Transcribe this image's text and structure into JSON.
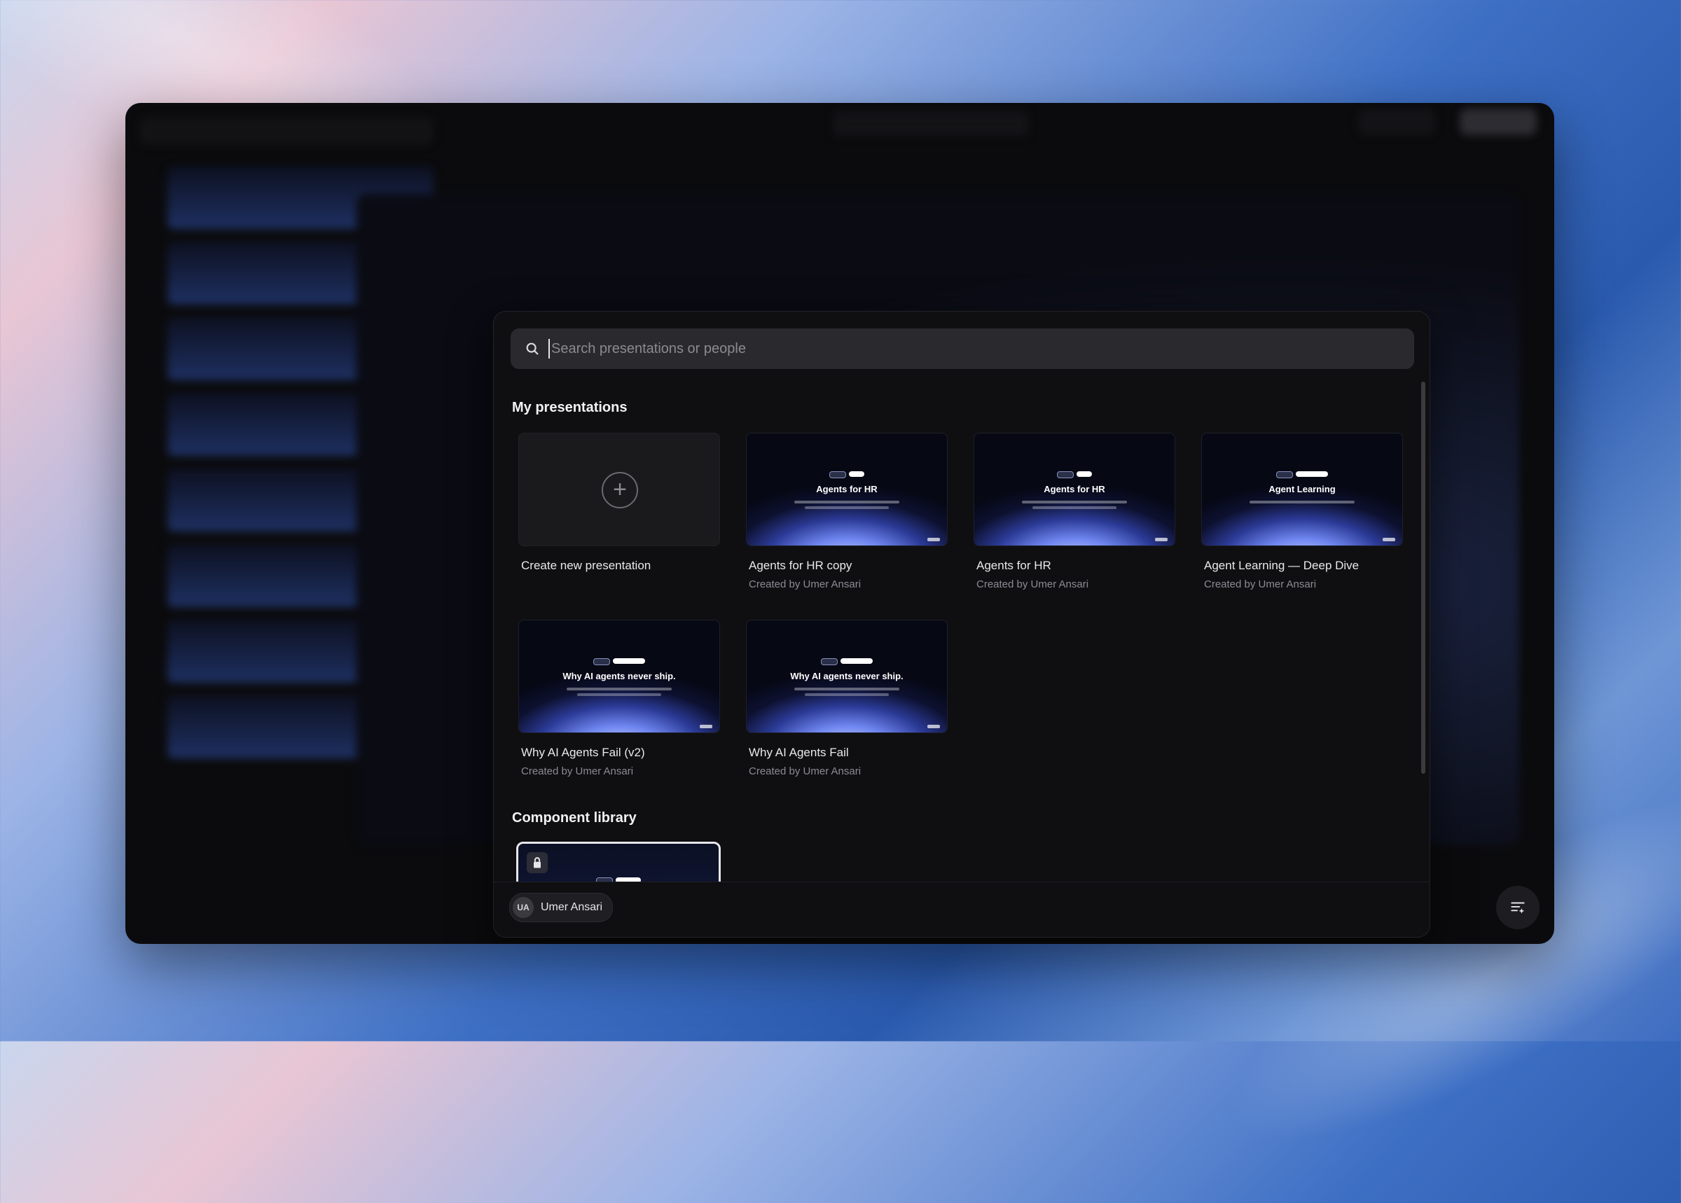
{
  "search": {
    "placeholder": "Search presentations or people"
  },
  "sections": {
    "my_presentations": "My presentations",
    "component_library": "Component library"
  },
  "new_card": {
    "label": "Create new presentation"
  },
  "presentations": [
    {
      "name": "Agents for HR copy",
      "creator": "Created by Umer Ansari",
      "thumb_title": "Agents for HR"
    },
    {
      "name": "Agents for HR",
      "creator": "Created by Umer Ansari",
      "thumb_title": "Agents for HR"
    },
    {
      "name": "Agent Learning — Deep Dive",
      "creator": "Created by Umer Ansari",
      "thumb_title": "Agent Learning"
    },
    {
      "name": "Why AI Agents Fail (v2)",
      "creator": "Created by Umer Ansari",
      "thumb_title": "Why AI agents never ship."
    },
    {
      "name": "Why AI Agents Fail",
      "creator": "Created by Umer Ansari",
      "thumb_title": "Why AI agents never ship."
    }
  ],
  "user": {
    "initials": "UA",
    "name": "Umer Ansari"
  },
  "icons": {
    "search": "search-icon",
    "plus": "plus-icon",
    "lock": "lock-icon",
    "fab": "list-sparkle-icon"
  }
}
